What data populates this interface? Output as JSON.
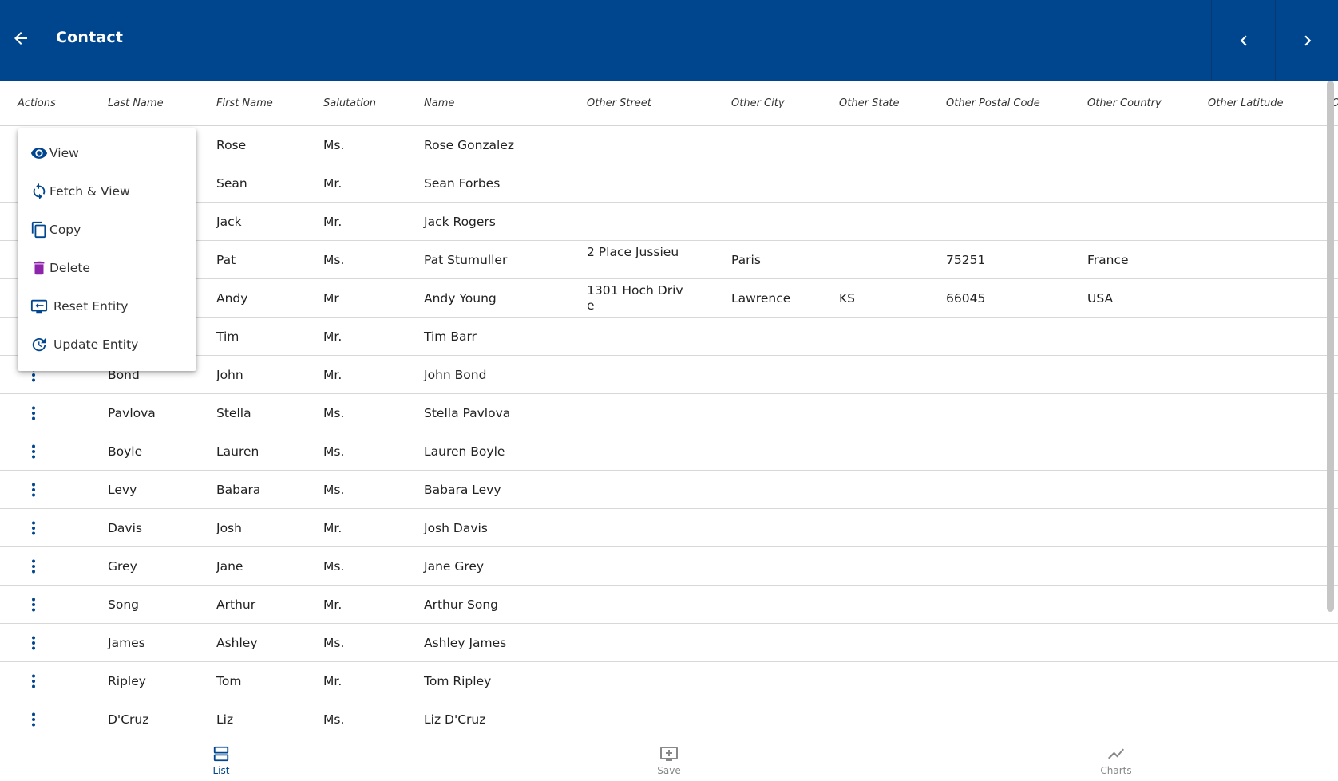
{
  "appbar": {
    "title": "Contact",
    "back_icon": "arrow-left-icon",
    "prev_icon": "chevron-left-icon",
    "next_icon": "chevron-right-icon",
    "color": "#00468e"
  },
  "table": {
    "columns": [
      "Actions",
      "Last Name",
      "First Name",
      "Salutation",
      "Name",
      "Other Street",
      "Other City",
      "Other State",
      "Other Postal Code",
      "Other Country",
      "Other Latitude",
      "O"
    ],
    "rows": [
      {
        "last": "",
        "first": "Rose",
        "salutation": "Ms.",
        "name": "Rose Gonzalez",
        "street": "",
        "city": "",
        "state": "",
        "postal": "",
        "country": ""
      },
      {
        "last": "",
        "first": "Sean",
        "salutation": "Mr.",
        "name": "Sean Forbes",
        "street": "",
        "city": "",
        "state": "",
        "postal": "",
        "country": ""
      },
      {
        "last": "",
        "first": "Jack",
        "salutation": "Mr.",
        "name": "Jack Rogers",
        "street": "",
        "city": "",
        "state": "",
        "postal": "",
        "country": ""
      },
      {
        "last": "",
        "first": "Pat",
        "salutation": "Ms.",
        "name": "Pat Stumuller",
        "street": "2 Place Jussieu",
        "city": "Paris",
        "state": "",
        "postal": "75251",
        "country": "France"
      },
      {
        "last": "",
        "first": "Andy",
        "salutation": "Mr",
        "name": "Andy Young",
        "street": "1301 Hoch Drive",
        "city": "Lawrence",
        "state": "KS",
        "postal": "66045",
        "country": "USA"
      },
      {
        "last": "",
        "first": "Tim",
        "salutation": "Mr.",
        "name": "Tim Barr",
        "street": "",
        "city": "",
        "state": "",
        "postal": "",
        "country": ""
      },
      {
        "last": "Bond",
        "first": "John",
        "salutation": "Mr.",
        "name": "John Bond",
        "street": "",
        "city": "",
        "state": "",
        "postal": "",
        "country": ""
      },
      {
        "last": "Pavlova",
        "first": "Stella",
        "salutation": "Ms.",
        "name": "Stella Pavlova",
        "street": "",
        "city": "",
        "state": "",
        "postal": "",
        "country": ""
      },
      {
        "last": "Boyle",
        "first": "Lauren",
        "salutation": "Ms.",
        "name": "Lauren Boyle",
        "street": "",
        "city": "",
        "state": "",
        "postal": "",
        "country": ""
      },
      {
        "last": "Levy",
        "first": "Babara",
        "salutation": "Ms.",
        "name": "Babara Levy",
        "street": "",
        "city": "",
        "state": "",
        "postal": "",
        "country": ""
      },
      {
        "last": "Davis",
        "first": "Josh",
        "salutation": "Mr.",
        "name": "Josh Davis",
        "street": "",
        "city": "",
        "state": "",
        "postal": "",
        "country": ""
      },
      {
        "last": "Grey",
        "first": "Jane",
        "salutation": "Ms.",
        "name": "Jane Grey",
        "street": "",
        "city": "",
        "state": "",
        "postal": "",
        "country": ""
      },
      {
        "last": "Song",
        "first": "Arthur",
        "salutation": "Mr.",
        "name": "Arthur Song",
        "street": "",
        "city": "",
        "state": "",
        "postal": "",
        "country": ""
      },
      {
        "last": "James",
        "first": "Ashley",
        "salutation": "Ms.",
        "name": "Ashley James",
        "street": "",
        "city": "",
        "state": "",
        "postal": "",
        "country": ""
      },
      {
        "last": "Ripley",
        "first": "Tom",
        "salutation": "Mr.",
        "name": "Tom Ripley",
        "street": "",
        "city": "",
        "state": "",
        "postal": "",
        "country": ""
      },
      {
        "last": "D'Cruz",
        "first": "Liz",
        "salutation": "Ms.",
        "name": "Liz D'Cruz",
        "street": "",
        "city": "",
        "state": "",
        "postal": "",
        "country": ""
      }
    ],
    "row_action_icon": "more-vertical-icon"
  },
  "context_menu": {
    "items": [
      {
        "label": "View",
        "icon": "eye-icon",
        "color": "#00468e"
      },
      {
        "label": "Fetch & View",
        "icon": "refresh-icon",
        "color": "#00468e"
      },
      {
        "label": "Copy",
        "icon": "copy-icon",
        "color": "#00468e"
      },
      {
        "label": "Delete",
        "icon": "trash-icon",
        "color": "#8e24aa"
      },
      {
        "label": "Reset Entity",
        "icon": "reset-entity-icon",
        "color": "#00468e"
      },
      {
        "label": "Update Entity",
        "icon": "update-icon",
        "color": "#00468e"
      }
    ]
  },
  "bottom_nav": {
    "items": [
      {
        "label": "List",
        "icon": "list-icon",
        "active": true
      },
      {
        "label": "Save",
        "icon": "save-icon",
        "active": false
      },
      {
        "label": "Charts",
        "icon": "chart-icon",
        "active": false
      }
    ],
    "active_color": "#00468e"
  }
}
